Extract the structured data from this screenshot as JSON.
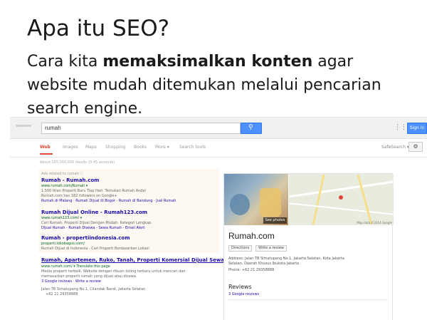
{
  "slide": {
    "title": "Apa itu SEO?",
    "body_part1": "Cara kita ",
    "body_bold": "memaksimalkan konten",
    "body_part2": " agar website mudah ditemukan melalui pencarian search engine."
  },
  "browser": {
    "search_query": "rumah",
    "search_icon": "magnifier-icon",
    "signin_label": "Sign in",
    "tabs": [
      "Web",
      "Images",
      "Maps",
      "Shopping",
      "Books",
      "More ▾",
      "Search tools"
    ],
    "safesearch_label": "SafeSearch ▾",
    "stats": "About 165,000,000 results (0.45 seconds)"
  },
  "ads": {
    "label": "Ads related to rumah ⓘ",
    "items": [
      {
        "title": "Rumah - Rumah.com",
        "url": "www.rumah.com/Rumah ▾",
        "lines": [
          "1.500 Iklan Properti Baru Tiap Hari. Temukan Rumah Anda!",
          "Rumah.com has 182 followers on Google+",
          "Rumah di Malang · Rumah Dijual di Bogor · Rumah di Bandung · Jual Rumah"
        ]
      },
      {
        "title": "Rumah Dijual Online - Rumah123.com",
        "url": "www.rumah123.com/ ▾",
        "lines": [
          "Cari Rumah, Properti Dijual Dengan Mudah. Kategori Lengkap.",
          "Dijual Rumah - Rumah Disewa - Sewa Rumah - Email Alert"
        ]
      },
      {
        "title": "Rumah - propertiindonesia.com",
        "url": "properti.lokobagus.com/",
        "lines": [
          "Rumah Dijual di Indonesia - Cari Properti Berdasarkan Lokasi"
        ]
      }
    ]
  },
  "organic": {
    "title": "Rumah, Apartemen, Ruko, Tanah, Properti Komersial Dijual Sewa",
    "url": "www.rumah.com/ ▾ Translate this page",
    "lines": [
      "Media properti terbaik. Website dengan ribuan listing terbaru untuk mencari dan",
      "memasarkan properti rumah yang dijual atau disewa.",
      "3 Google reviews · Write a review"
    ],
    "address": "Jalan TB Simatupang No.1, Cilandak Barat, Jakarta Selatan",
    "phone": "+62 21 29358888"
  },
  "panel": {
    "title": "Rumah.com",
    "see_photos": "See photos",
    "map_credit": "Map data ©2014 Google",
    "buttons": [
      "Directions",
      "Write a review"
    ],
    "address": "Address: Jalan TB Simatupang No.1, Jakarta Selatan, Kota Jakarta",
    "address2": "Selatan, Daerah Khusus Ibukota Jakarta",
    "phone": "Phone: +62 21 29358888",
    "reviews_heading": "Reviews",
    "reviews_link": "3 Google reviews"
  }
}
